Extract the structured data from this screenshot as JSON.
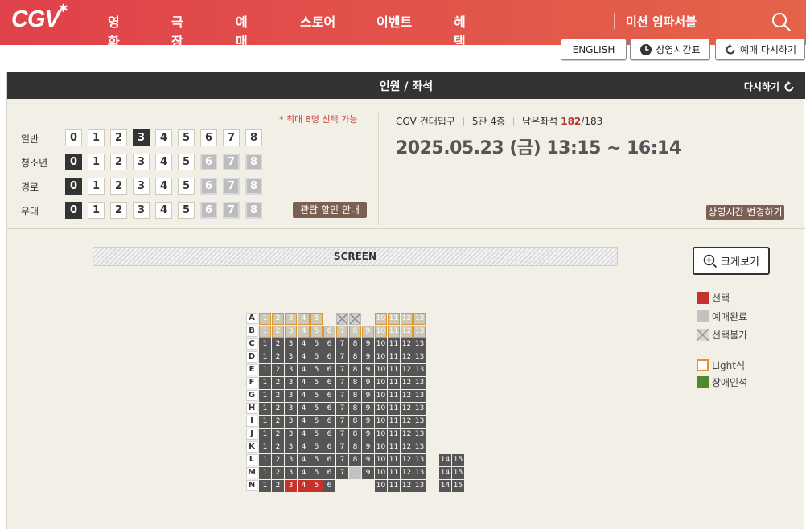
{
  "header": {
    "logo": "CGV",
    "nav": [
      "영화",
      "극장",
      "예매",
      "스토어",
      "이벤트",
      "혜택"
    ],
    "mission": "미션 임파서블"
  },
  "buttons": {
    "english": "ENGLISH",
    "schedule": "상영시간표",
    "rebook": "예매 다시하기"
  },
  "panel": {
    "title": "인원 / 좌석",
    "reset": "다시하기",
    "max_note": "* 최대 8명 선택 가능",
    "discount_btn": "관람 할인 안내",
    "change_time_btn": "상영시간 변경하기"
  },
  "people": [
    {
      "label": "일반",
      "selected": 3,
      "max_enabled": 8
    },
    {
      "label": "청소년",
      "selected": 0,
      "max_enabled": 5
    },
    {
      "label": "경로",
      "selected": 0,
      "max_enabled": 5
    },
    {
      "label": "우대",
      "selected": 0,
      "max_enabled": 5
    }
  ],
  "movie_info": {
    "theater": "CGV 건대입구",
    "hall": "5관 4층",
    "remain_label": "남은좌석",
    "remain": "182",
    "total": "/183",
    "datetime": "2025.05.23 (금) 13:15 ~ 16:14"
  },
  "screen_label": "SCREEN",
  "zoom_label": "크게보기",
  "legend": [
    {
      "label": "선택",
      "type": "selected",
      "color": "#c5322b"
    },
    {
      "label": "예매완료",
      "type": "sold",
      "color": "#c2c2c2"
    },
    {
      "label": "선택불가",
      "type": "unavailable",
      "color": "#d1d1d1"
    },
    {
      "label": "Light석",
      "type": "light",
      "color": "#e0952f"
    },
    {
      "label": "장애인석",
      "type": "disabled",
      "color": "#4e8a2d"
    }
  ],
  "seat_rows": [
    "A",
    "B",
    "C",
    "D",
    "E",
    "F",
    "G",
    "H",
    "I",
    "J",
    "K",
    "L",
    "M",
    "N"
  ],
  "seat_status": {
    "selected": [
      "N3",
      "N4",
      "N5"
    ],
    "sold": [
      "M8"
    ],
    "light_rows": [
      "A",
      "B"
    ],
    "unavailable": [
      "A7",
      "A8"
    ],
    "extra_seats_rows": [
      "L",
      "M",
      "N"
    ],
    "missing": [
      "A6",
      "A9",
      "N7",
      "N8",
      "N9"
    ]
  }
}
